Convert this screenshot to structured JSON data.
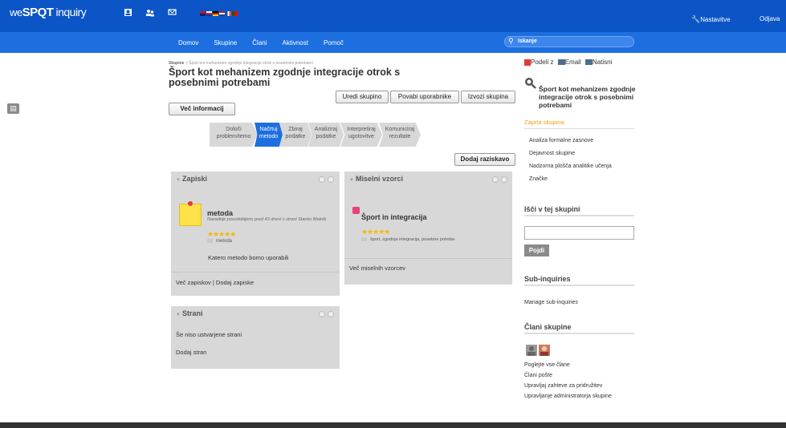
{
  "header": {
    "logo_prefix": "we",
    "logo_main": "SPQT",
    "logo_suffix": "inquiry",
    "settings": "Nastavitve",
    "logout": "Odjava",
    "icons": [
      "contacts-icon",
      "users-icon",
      "mail-icon"
    ],
    "brand_color": "#0b55c7"
  },
  "nav": {
    "items": [
      "Domov",
      "Skupine",
      "Člani",
      "Aktivnost",
      "Pomoč"
    ],
    "search_placeholder": "Iskanje"
  },
  "breadcrumb": {
    "root": "Skupine",
    "rest": " > Šport kot mehanizem zgodnje integracije otrok s posebnimi potrebami"
  },
  "page": {
    "title": "Šport kot mehanizem zgodnje integracije otrok s posebnimi potrebami",
    "more_info": "Več informacij",
    "edit_group": "Uredi skupino",
    "invite_users": "Povabi uporabnike",
    "export_group": "Izvozi skupina",
    "add_research": "Dodaj raziskavo"
  },
  "steps": [
    {
      "label": "Določi problem/temo",
      "active": false
    },
    {
      "label": "Načrtuj metodo",
      "active": true
    },
    {
      "label": "Zbiraj podatke",
      "active": false
    },
    {
      "label": "Analiziraj podatke",
      "active": false
    },
    {
      "label": "Interpretiraj ugotovitve",
      "active": false
    },
    {
      "label": "Komuniciraj rezultate",
      "active": false
    }
  ],
  "notes_panel": {
    "title": "Zapiski",
    "item_title": "metoda",
    "item_meta": "Nazadnje posodobljeno pred 43 dnevi s strani Stanko Blatnik",
    "stars": "★★★★★",
    "tag": "metoda",
    "question": "Katero metodo bomo uporabili",
    "more_notes": "Več zapiskov",
    "separator": " | ",
    "add_notes": "Dodaj zapiske"
  },
  "mindmap_panel": {
    "title": "Miselni vzorci",
    "item_title": "Šport in integracija",
    "stars": "★★★★★",
    "tags": "šport,  zgodnja integracija,  posebne potrebe",
    "more": "Več miselnih vzorcev"
  },
  "pages_panel": {
    "title": "Strani",
    "empty": "Še niso ustvarjene strani",
    "add": "Dodaj stran"
  },
  "sidebar": {
    "share": "Podeli z",
    "email": "Email",
    "print": "Natisni",
    "group_title": "Šport kot mehanizem zgodnje integracije otrok s posebnimi potrebami",
    "closed_group": "Zaprta skupina",
    "links": [
      "Analiza formalne zasnove",
      "Dejavnost skupine",
      "Nadzorna plošča analitike učenja",
      "Značke"
    ],
    "search_heading": "Išči v tej skupini",
    "search_button": "Pojdi",
    "sub_heading": "Sub-inquiries",
    "sub_link": "Manage sub-inquiries",
    "members_heading": "Člani skupine",
    "member_links": [
      "Poglejte vse člane",
      "Člani pošte",
      "Upravljaj zahteve za pridružitev",
      "Upravljanje administratorja skupine"
    ]
  }
}
